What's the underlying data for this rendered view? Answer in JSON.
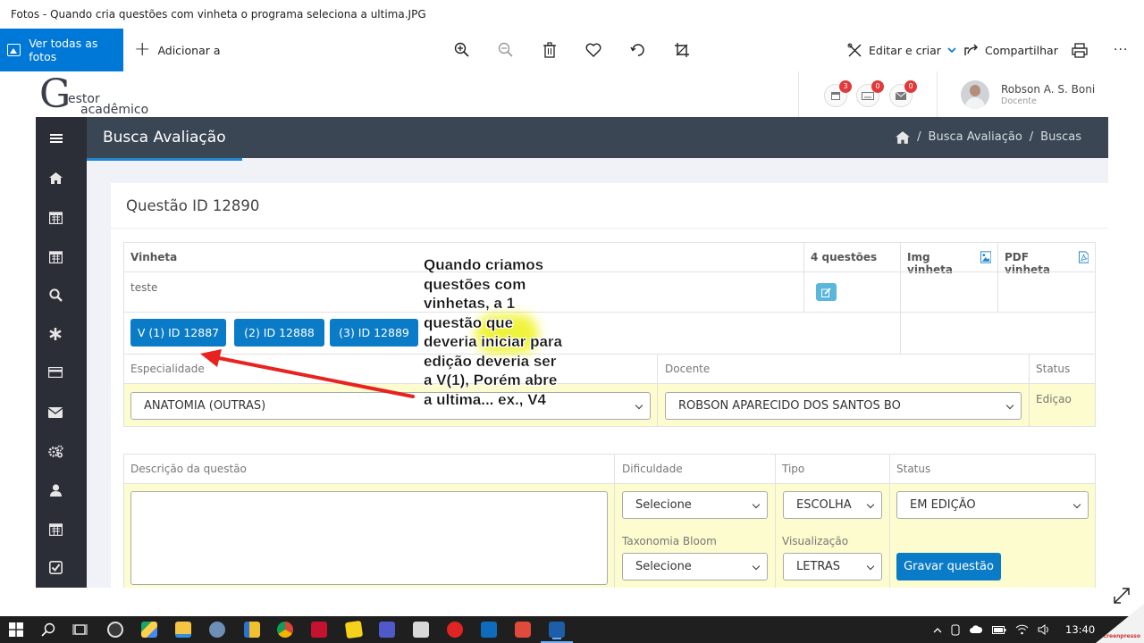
{
  "window": {
    "title": "Fotos - Quando cria questões com vinheta o programa seleciona a ultima.JPG"
  },
  "appbar": {
    "view_all": "Ver todas as fotos",
    "add_to": "Adicionar a",
    "edit_create": "Editar e criar",
    "share": "Compartilhar",
    "more": "···"
  },
  "site": {
    "logo_letter": "G",
    "logo_word1": "estor",
    "logo_word2": "acadêmico",
    "badges": {
      "calendar": "3",
      "keyboard": "0",
      "mail": "0"
    },
    "user_name": "Robson A. S. Boni",
    "user_role": "Docente",
    "page_title": "Busca Avaliação",
    "breadcrumb": [
      "Busca Avaliação",
      "Buscas"
    ],
    "breadcrumb_sep": "/"
  },
  "question": {
    "title": "Questão ID 12890",
    "vinheta_header": "Vinheta",
    "count_header": "4 questões",
    "img_header": "Img vinheta",
    "pdf_header": "PDF vinheta",
    "vinheta_text": "teste",
    "buttons": [
      "V (1) ID 12887",
      "(2) ID 12888",
      "(3) ID 12889"
    ],
    "especialidade_label": "Especialidade",
    "especialidade_value": "ANATOMIA (OUTRAS)",
    "docente_label": "Docente",
    "docente_value": "ROBSON APARECIDO DOS SANTOS BO",
    "status_label": "Status",
    "status_value": "Ediçao",
    "descricao_label": "Descrição da questão",
    "dificuldade_label": "Dificuldade",
    "dificuldade_value": "Selecione",
    "tipo_label": "Tipo",
    "tipo_value": "ESCOLHA",
    "status2_label": "Status",
    "status2_value": "EM EDIÇÃO",
    "taxonomia_label": "Taxonomia Bloom",
    "taxonomia_value": "Selecione",
    "visualizacao_label": "Visualização",
    "visualizacao_value": "LETRAS",
    "save_button": "Gravar questão"
  },
  "annotation": {
    "text": "Quando criamos\nquestões com\nvinhetas, a 1\nquestão que\ndeveria iniciar para\nedição deveria ser\na V(1), Porém abre\na ultima... ex., V4",
    "arrow_color": "#e8231f",
    "highlight_color": "#eef21a"
  },
  "taskbar": {
    "time": "13:40"
  },
  "watermark": "Screenpresso",
  "colors": {
    "accent": "#0078d7",
    "site_blue": "#0a7bc6",
    "topbar": "#3a4654",
    "sidebar": "#2b2e36"
  }
}
